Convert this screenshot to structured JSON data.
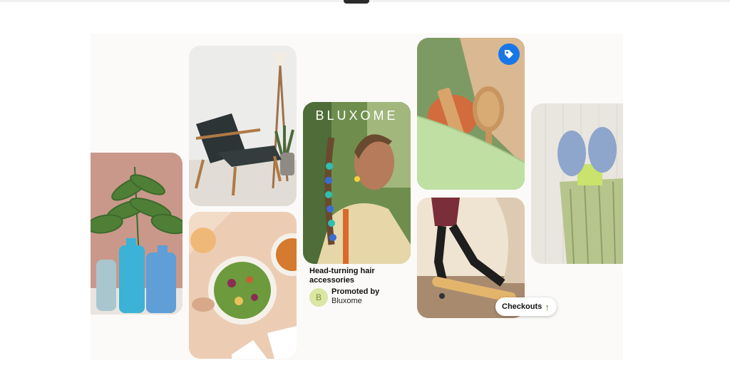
{
  "pins": [
    {
      "name": "plant-vases-pin",
      "image": "plant-in-blue-bottles-image"
    },
    {
      "name": "chair-pin",
      "image": "wooden-lounge-chair-image"
    },
    {
      "name": "salad-pin",
      "image": "salad-bowl-image"
    },
    {
      "name": "promoted-pin",
      "image": "woman-braided-hair-image",
      "brand": "BLUXOME",
      "title": "Head-turning hair accessories",
      "promoted_label": "Promoted by",
      "advertiser": "Bluxome",
      "avatar_letter": "B"
    },
    {
      "name": "comb-pin",
      "image": "wooden-comb-and-brush-image",
      "badge_icon": "tag-icon"
    },
    {
      "name": "skateboard-pin",
      "image": "person-skateboarding-image"
    },
    {
      "name": "socks-pin",
      "image": "fuzzy-socks-image"
    }
  ],
  "checkouts_badge": {
    "label": "Checkouts",
    "icon": "arrow-up-icon"
  },
  "colors": {
    "badge_blue": "#1877e6",
    "avatar_green": "#d9e6a4",
    "arrow_green": "#4f8a1f"
  }
}
